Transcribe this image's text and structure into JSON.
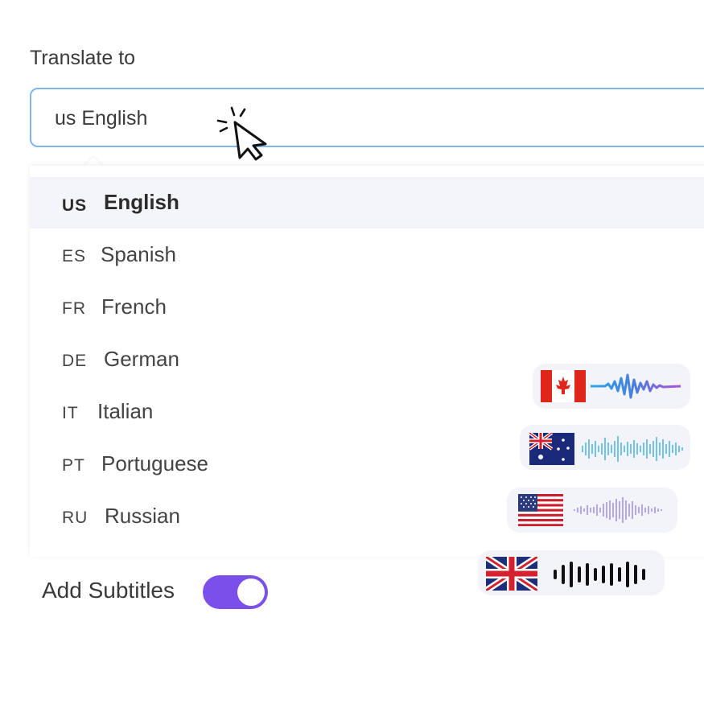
{
  "form": {
    "label": "Translate to",
    "selected_value": "us English"
  },
  "languages": [
    {
      "code": "US",
      "name": "English",
      "selected": true
    },
    {
      "code": "ES",
      "name": "Spanish",
      "selected": false
    },
    {
      "code": "FR",
      "name": "French",
      "selected": false
    },
    {
      "code": "DE",
      "name": "German",
      "selected": false
    },
    {
      "code": "IT",
      "name": "Italian",
      "selected": false
    },
    {
      "code": "PT",
      "name": "Portuguese",
      "selected": false
    },
    {
      "code": "RU",
      "name": "Russian",
      "selected": false
    }
  ],
  "subtitles": {
    "label": "Add Subtitles",
    "enabled": true
  },
  "voice_chips": [
    {
      "flag": "canada-flag-icon",
      "waveform": "gradient-waveform-icon"
    },
    {
      "flag": "australia-flag-icon",
      "waveform": "blue-waveform-icon"
    },
    {
      "flag": "usa-flag-icon",
      "waveform": "purple-waveform-icon"
    },
    {
      "flag": "uk-flag-icon",
      "waveform": "black-waveform-icon"
    }
  ],
  "colors": {
    "accent": "#7b4fe9",
    "focus_border": "#7fb6ef",
    "selected_row": "#f4f5f9"
  }
}
